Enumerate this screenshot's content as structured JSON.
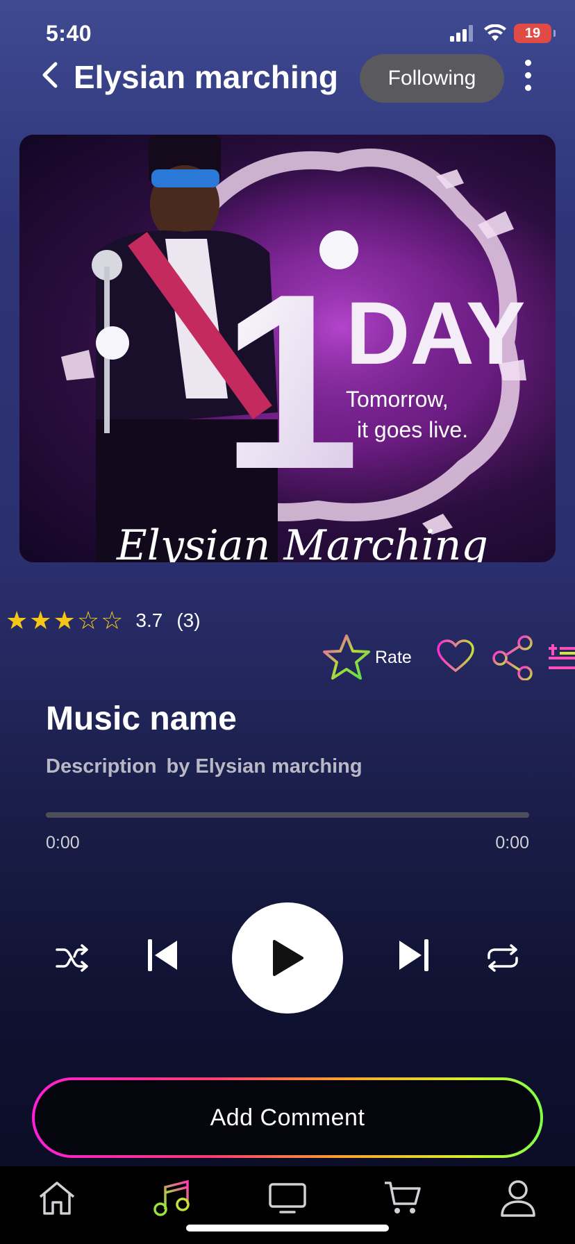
{
  "status_bar": {
    "time": "5:40",
    "battery": "19"
  },
  "header": {
    "title": "Elysian marching",
    "follow_label": "Following"
  },
  "cover": {
    "headline_number": "1",
    "headline_word": "DAY",
    "tagline_line1": "Tomorrow,",
    "tagline_line2": "it goes live.",
    "script_text": "Elysian Marching"
  },
  "rating": {
    "value": "3.7",
    "count": "(3)",
    "filled_stars": 3,
    "total_stars": 5
  },
  "actions": {
    "rate_label": "Rate"
  },
  "track": {
    "title": "Music name",
    "description": "Description",
    "artist": "by Elysian marching",
    "time_current": "0:00",
    "time_total": "0:00",
    "progress": 0
  },
  "comment": {
    "label": "Add Comment"
  },
  "colors": {
    "star": "#f5c518",
    "music_tab_accent": "#9be33a",
    "follow_bg": "#5a5a5e"
  },
  "tabs": [
    "home-icon",
    "music-icon",
    "tv-icon",
    "cart-icon",
    "profile-icon"
  ]
}
